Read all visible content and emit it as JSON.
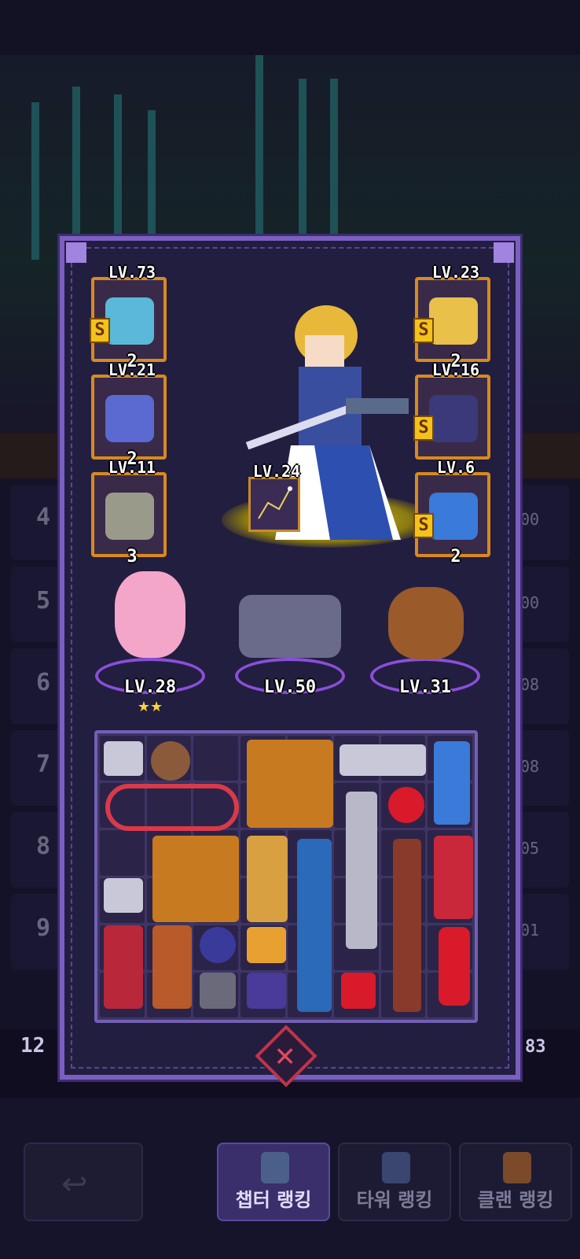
{
  "ranking_rows": [
    {
      "rank": "4",
      "score": "00"
    },
    {
      "rank": "5",
      "score": "00"
    },
    {
      "rank": "6",
      "score": "08"
    },
    {
      "rank": "7",
      "score": "08"
    },
    {
      "rank": "8",
      "score": "05"
    },
    {
      "rank": "9",
      "score": "01"
    }
  ],
  "my_rank": {
    "rank": "12",
    "score": "83"
  },
  "left_equipment": [
    {
      "level": "LV.73",
      "count": "2",
      "has_s": true
    },
    {
      "level": "LV.21",
      "count": "2",
      "has_s": false
    },
    {
      "level": "LV.11",
      "count": "3",
      "has_s": false
    }
  ],
  "right_equipment": [
    {
      "level": "LV.23",
      "count": "2",
      "has_s": true
    },
    {
      "level": "LV.16",
      "count": "",
      "has_s": true
    },
    {
      "level": "LV.6",
      "count": "2",
      "has_s": true
    }
  ],
  "skill": {
    "level": "LV.24"
  },
  "pets": [
    {
      "level": "LV.28",
      "stars": "★★"
    },
    {
      "level": "LV.50",
      "stars": ""
    },
    {
      "level": "LV.31",
      "stars": ""
    }
  ],
  "s_letter": "S",
  "close_glyph": "✕",
  "back_glyph": "↩",
  "tabs": [
    {
      "label": "챕터 랭킹",
      "active": true
    },
    {
      "label": "타워 랭킹",
      "active": false
    },
    {
      "label": "클랜 랭킹",
      "active": false
    }
  ],
  "colors": {
    "panel_border": "#7b5fc0",
    "equip_border": "#d78a1e",
    "close_accent": "#c0344a",
    "glow": "#e0cb2a"
  }
}
